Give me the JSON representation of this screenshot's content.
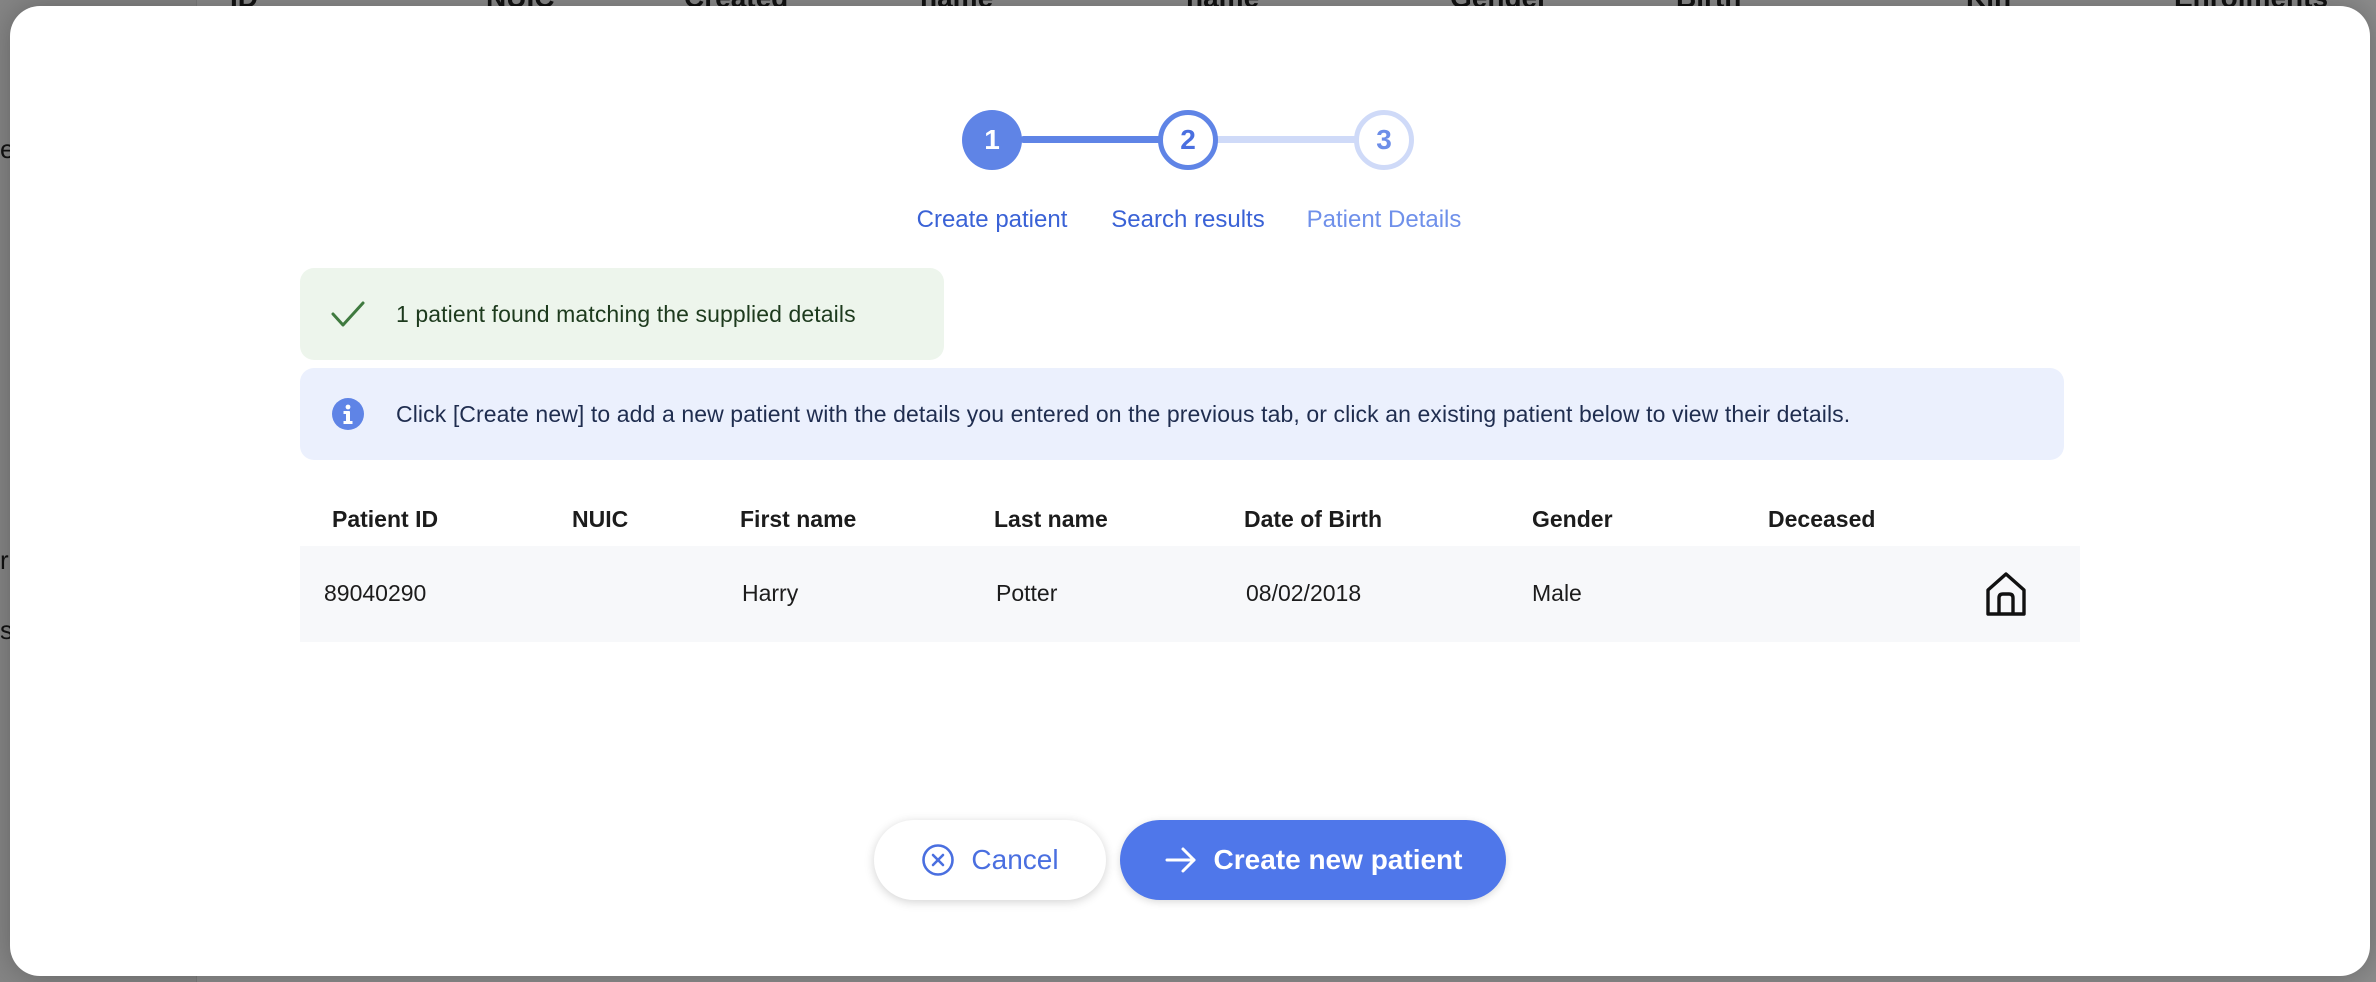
{
  "background": {
    "headers": [
      "ID",
      "NUIC",
      "Created",
      "name",
      "name",
      "Gender",
      "Birth",
      "Kin",
      "Enrolments"
    ],
    "side_texts": [
      "er",
      "r",
      "s"
    ]
  },
  "stepper": {
    "steps": [
      {
        "number": "1",
        "label": "Create patient",
        "state": "complete"
      },
      {
        "number": "2",
        "label": "Search results",
        "state": "active"
      },
      {
        "number": "3",
        "label": "Patient Details",
        "state": "upcoming"
      }
    ]
  },
  "alerts": {
    "success": {
      "text": "1 patient found matching the supplied details",
      "icon": "check-icon"
    },
    "info": {
      "text": "Click [Create new] to add a new patient with the details you entered on the previous tab, or click an existing patient below to view their details.",
      "icon": "info-icon"
    }
  },
  "table": {
    "headers": [
      "Patient ID",
      "NUIC",
      "First name",
      "Last name",
      "Date of Birth",
      "Gender",
      "Deceased"
    ],
    "rows": [
      {
        "patient_id": "89040290",
        "nuic": "",
        "first_name": "Harry",
        "last_name": "Potter",
        "dob": "08/02/2018",
        "gender": "Male",
        "deceased": "",
        "action_icon": "home-icon"
      }
    ]
  },
  "buttons": {
    "cancel": {
      "label": "Cancel",
      "icon": "cancel-circle-icon"
    },
    "create": {
      "label": "Create new patient",
      "icon": "arrow-right-icon"
    }
  },
  "colors": {
    "primary": "#4f77ea",
    "step_complete": "#5f84e6",
    "step_upcoming": "#cfdaf8",
    "success_bg": "#edf5ec",
    "info_bg": "#ebf0fd"
  }
}
